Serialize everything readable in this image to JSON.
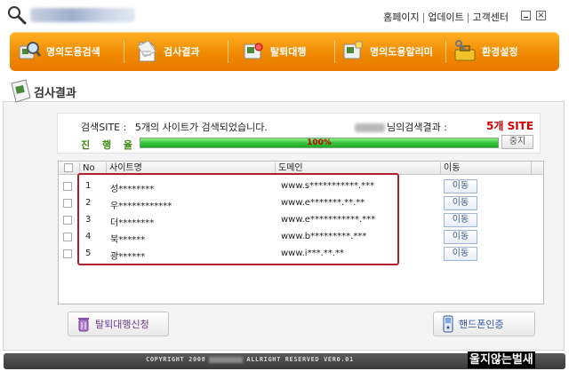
{
  "titlebar": {
    "links": [
      "홈페이지",
      "업데이트",
      "고객센터"
    ]
  },
  "nav": {
    "items": [
      {
        "label": "명의도용검색",
        "icon": "magnifier-id-card-icon"
      },
      {
        "label": "검사결과",
        "icon": "document-result-icon"
      },
      {
        "label": "탈퇴대행",
        "icon": "withdraw-agent-icon"
      },
      {
        "label": "명의도용알리미",
        "icon": "alert-id-card-icon"
      },
      {
        "label": "환경설정",
        "icon": "settings-toolbox-icon"
      }
    ]
  },
  "section": {
    "title": "검사결과"
  },
  "search": {
    "site_label": "검색SITE :",
    "site_message": "5개의 사이트가 검색되었습니다.",
    "result_suffix": "님의검색결과 :",
    "count": "5개 SITE",
    "progress_label": "진 행 율",
    "progress_value": 1.0,
    "progress_text": "100%",
    "stop_label": "중지"
  },
  "table": {
    "headers": {
      "no": "No",
      "site": "사이트명",
      "domain": "도메인",
      "move": "이동"
    },
    "rows": [
      {
        "no": "1",
        "site": "성********",
        "domain": "www.s***********.***",
        "move": "이동"
      },
      {
        "no": "2",
        "site": "우************",
        "domain": "www.e*******.**.**",
        "move": "이동"
      },
      {
        "no": "3",
        "site": "더********",
        "domain": "www.e***********.***",
        "move": "이동"
      },
      {
        "no": "4",
        "site": "북******",
        "domain": "www.b*********.***",
        "move": "이동"
      },
      {
        "no": "5",
        "site": "광******",
        "domain": "www.i***.**.**",
        "move": "이동"
      }
    ]
  },
  "buttons": {
    "apply": "탈퇴대행신청",
    "phone": "핸드폰인증"
  },
  "footer": {
    "copyright_left": "COPYRIGHT 2008",
    "copyright_right": "ALLRIGHT RESERVED VER0.01"
  },
  "watermark": "울지않는벌새",
  "colors": {
    "nav_orange": "#f08a00",
    "count_red": "#d00000",
    "progress_green": "#35c43b",
    "highlight_red": "#b0202c"
  }
}
